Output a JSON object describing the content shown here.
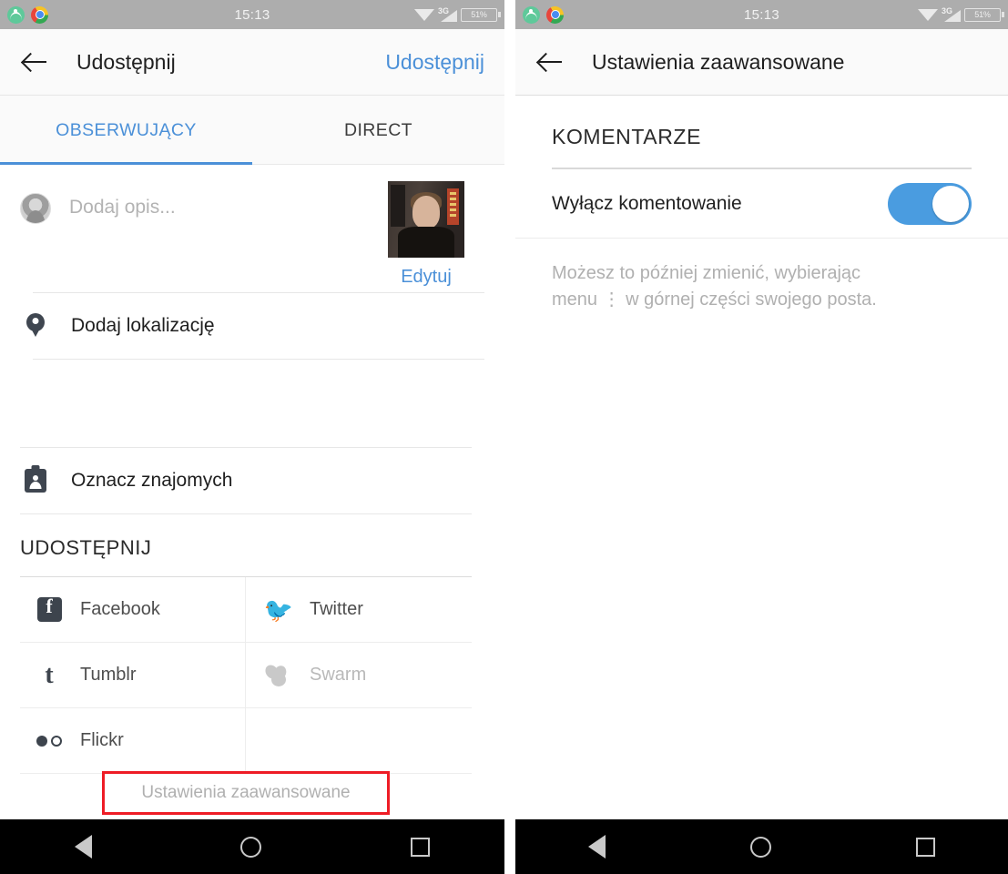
{
  "status_bar": {
    "clock": "15:13",
    "network_type": "3G",
    "battery_text": "51%",
    "icons": [
      "fitness-app-icon",
      "chrome-icon",
      "wifi-icon",
      "cellular-signal-icon",
      "battery-icon"
    ]
  },
  "left_screen": {
    "appbar": {
      "back_label": "back-arrow",
      "title": "Udostępnij",
      "action": "Udostępnij"
    },
    "tabs": [
      {
        "label": "OBSERWUJĄCY",
        "active": true
      },
      {
        "label": "DIRECT",
        "active": false
      }
    ],
    "caption": {
      "placeholder": "Dodaj opis...",
      "value": "",
      "edit_label": "Edytuj"
    },
    "options": [
      {
        "label": "Dodaj lokalizację",
        "icon": "location-pin-icon"
      },
      {
        "label": "Oznacz znajomych",
        "icon": "tag-friends-icon"
      }
    ],
    "share_section": {
      "heading": "UDOSTĘPNIJ",
      "items": [
        {
          "label": "Facebook",
          "icon": "facebook-icon",
          "disabled": false
        },
        {
          "label": "Twitter",
          "icon": "twitter-icon",
          "disabled": false
        },
        {
          "label": "Tumblr",
          "icon": "tumblr-icon",
          "disabled": false
        },
        {
          "label": "Swarm",
          "icon": "swarm-icon",
          "disabled": true
        },
        {
          "label": "Flickr",
          "icon": "flickr-icon",
          "disabled": false
        }
      ]
    },
    "advanced_button": {
      "label": "Ustawienia zaawansowane",
      "highlight_color": "#ee1c25"
    }
  },
  "right_screen": {
    "appbar": {
      "back_label": "back-arrow",
      "title": "Ustawienia zaawansowane"
    },
    "section": {
      "heading": "KOMENTARZE",
      "toggle_label": "Wyłącz komentowanie",
      "toggle_on": true,
      "toggle_color": "#4a9ce0",
      "help_text": "Możesz to później zmienić, wybierając menu ⋮ w górnej części swojego posta."
    }
  },
  "nav_bar": {
    "back": "nav-back-icon",
    "home": "nav-home-icon",
    "recents": "nav-recents-icon"
  },
  "theme": {
    "accent_blue": "#4b90d8",
    "status_bar_bg": "#adadad",
    "appbar_bg": "#fafafa"
  }
}
